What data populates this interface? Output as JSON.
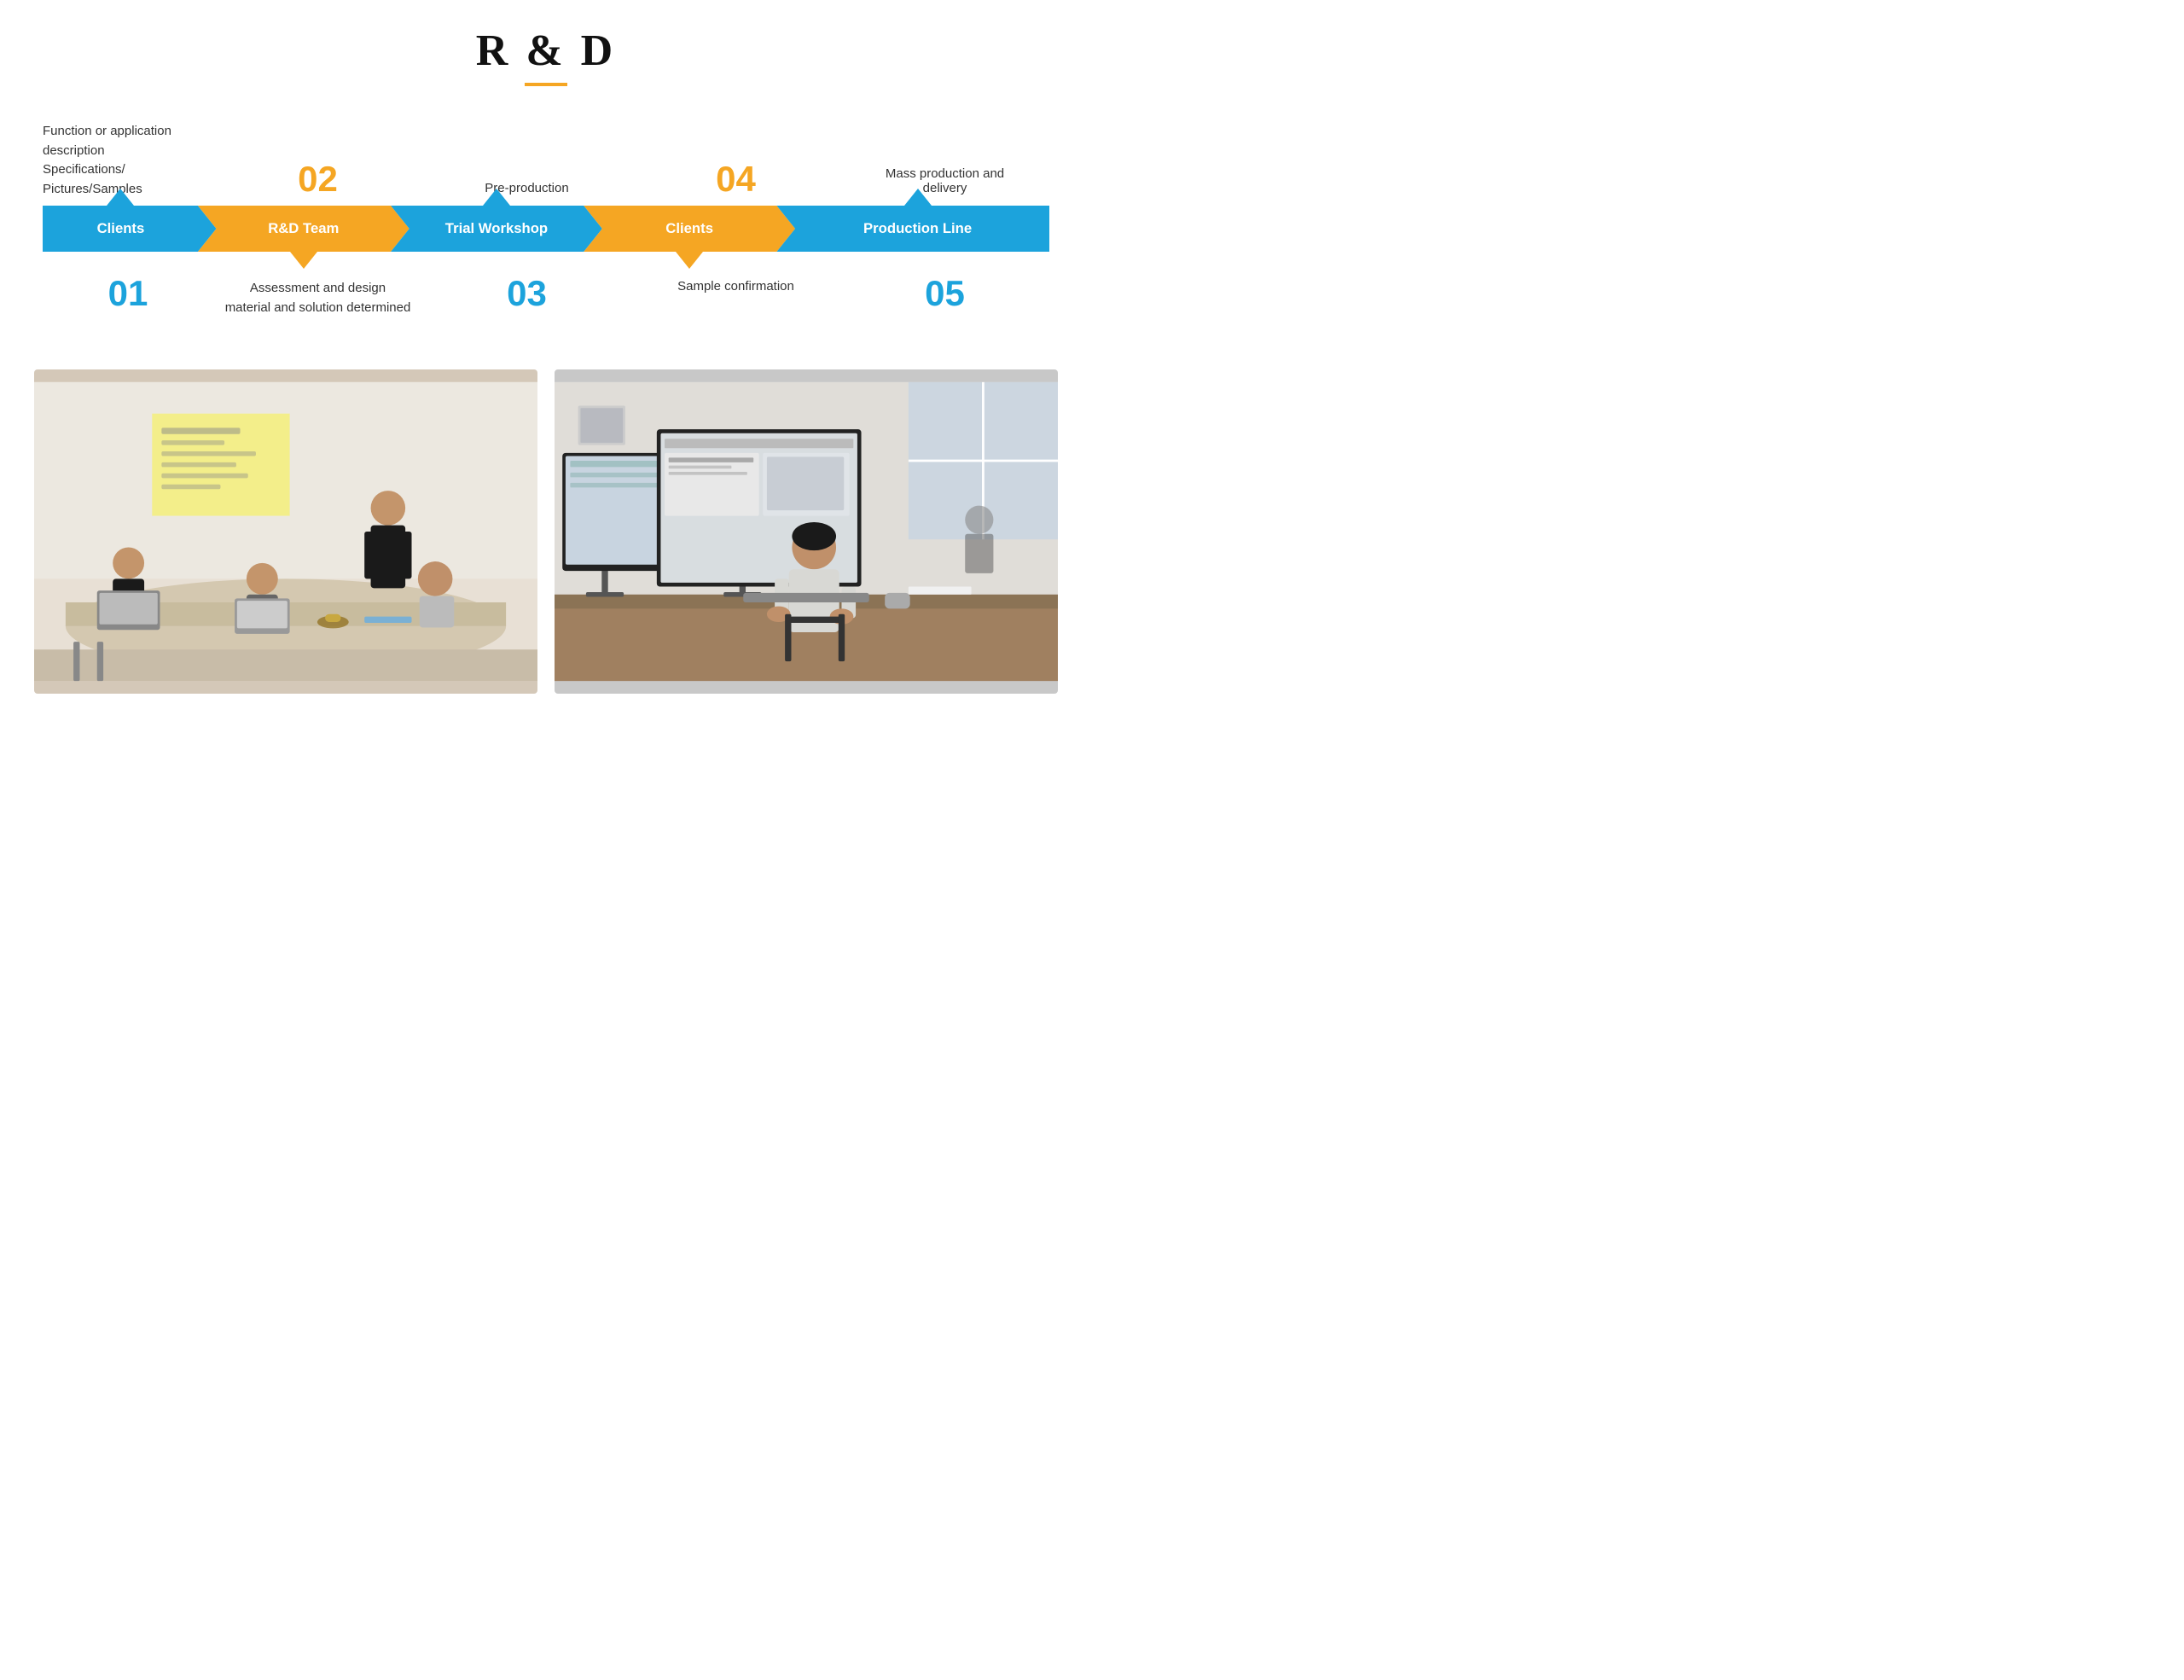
{
  "title": {
    "text": "R & D",
    "underline_color": "#f5a623"
  },
  "top_labels": [
    {
      "id": "step02",
      "number": "02",
      "description": "Pre-production"
    },
    {
      "id": "step04",
      "number": "04",
      "description": "Mass production and delivery"
    }
  ],
  "flow_segments": [
    {
      "id": "clients1",
      "label": "Clients",
      "type": "blue"
    },
    {
      "id": "rdteam",
      "label": "R&D Team",
      "type": "orange"
    },
    {
      "id": "trial",
      "label": "Trial Workshop",
      "type": "blue"
    },
    {
      "id": "clients2",
      "label": "Clients",
      "type": "orange"
    },
    {
      "id": "production",
      "label": "Production Line",
      "type": "blue"
    }
  ],
  "bottom_labels": [
    {
      "id": "step01",
      "number": "01",
      "description": ""
    },
    {
      "id": "step01desc",
      "number": "",
      "description": "Assessment and design material and solution determined"
    },
    {
      "id": "step03",
      "number": "03",
      "description": ""
    },
    {
      "id": "step03desc",
      "number": "",
      "description": "Sample confirmation"
    },
    {
      "id": "step05",
      "number": "05",
      "description": ""
    }
  ],
  "top_desc_left": {
    "line1": "Function or application",
    "line2": "description",
    "line3": "Specifications/",
    "line4": "Pictures/Samples"
  },
  "images": [
    {
      "id": "meeting-photo",
      "alt": "Team meeting photo"
    },
    {
      "id": "computer-photo",
      "alt": "Computer work photo"
    }
  ],
  "colors": {
    "blue": "#1ca3dc",
    "orange": "#f5a623",
    "text_dark": "#222222",
    "text_gray": "#444444"
  }
}
